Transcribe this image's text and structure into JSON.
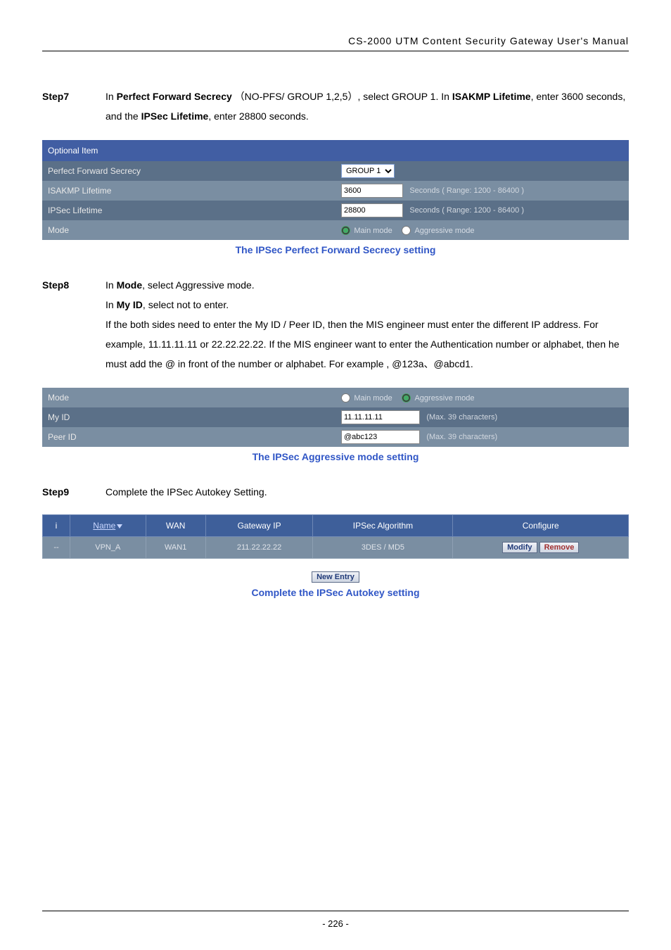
{
  "header": "CS-2000 UTM Content Security Gateway User's Manual",
  "steps": {
    "s7": {
      "label": "Step7",
      "text_pre": "In ",
      "b1": "Perfect Forward Secrecy",
      "text_mid1": " （NO-PFS/ GROUP 1,2,5）, select GROUP 1. In ",
      "b2": "ISAKMP Lifetime",
      "text_mid2": ", enter 3600 seconds, and the ",
      "b3": "IPSec Lifetime",
      "text_end": ", enter 28800 seconds."
    },
    "s8": {
      "label": "Step8",
      "l1a": "In ",
      "l1b": "Mode",
      "l1c": ", select Aggressive mode.",
      "l2a": "In ",
      "l2b": "My ID",
      "l2c": ", select not to enter.",
      "l3": "If the both sides need to enter the My ID / Peer ID, then the MIS engineer must enter the different IP address. For example, 11.11.11.11 or 22.22.22.22. If the MIS engineer want to enter the Authentication number or alphabet, then he must add the @ in front of the number or alphabet. For example ,   @123a、@abcd1."
    },
    "s9": {
      "label": "Step9",
      "text": "Complete the IPSec Autokey Setting."
    }
  },
  "table1": {
    "title": "Optional Item",
    "r1": {
      "label": "Perfect Forward Secrecy",
      "select_value": "GROUP 1"
    },
    "r2": {
      "label": "ISAKMP Lifetime",
      "value": "3600",
      "hint": "Seconds  ( Range: 1200 - 86400 )"
    },
    "r3": {
      "label": "IPSec Lifetime",
      "value": "28800",
      "hint": "Seconds  ( Range: 1200 - 86400 )"
    },
    "r4": {
      "label": "Mode",
      "opt1": "Main mode",
      "opt2": "Aggressive mode"
    }
  },
  "caption1": "The IPSec Perfect Forward Secrecy setting",
  "table2": {
    "r1": {
      "label": "Mode",
      "opt1": "Main mode",
      "opt2": "Aggressive mode"
    },
    "r2": {
      "label": "My ID",
      "value": "11.11.11.11",
      "hint": "(Max. 39 characters)"
    },
    "r3": {
      "label": "Peer ID",
      "value": "@abc123",
      "hint": "(Max. 39 characters)"
    }
  },
  "caption2": "The IPSec Aggressive mode setting",
  "sumtable": {
    "h1": "i",
    "h2": "Name",
    "h3": "WAN",
    "h4": "Gateway IP",
    "h5": "IPSec Algorithm",
    "h6": "Configure",
    "row": {
      "c1": "--",
      "c2": "VPN_A",
      "c3": "WAN1",
      "c4": "211.22.22.22",
      "c5": "3DES / MD5"
    },
    "btn_modify": "Modify",
    "btn_remove": "Remove"
  },
  "btn_new_entry": "New Entry",
  "caption3": "Complete the IPSec Autokey setting",
  "page_number": "- 226 -"
}
